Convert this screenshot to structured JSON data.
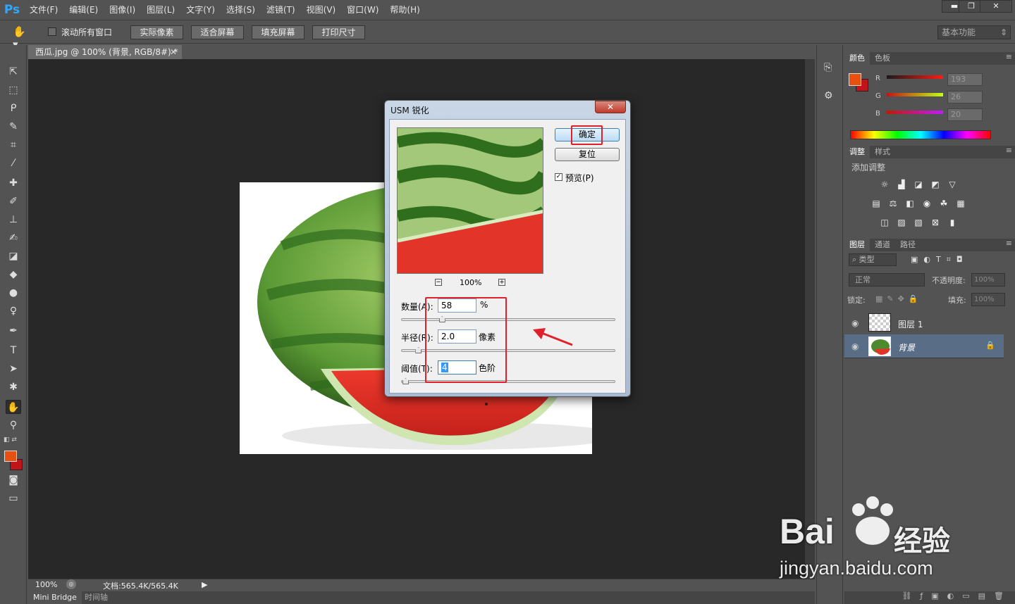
{
  "app": {
    "logo": "Ps"
  },
  "menu": [
    "文件(F)",
    "编辑(E)",
    "图像(I)",
    "图层(L)",
    "文字(Y)",
    "选择(S)",
    "滤镜(T)",
    "视图(V)",
    "窗口(W)",
    "帮助(H)"
  ],
  "window_buttons": [
    "▬",
    "❐",
    "✕"
  ],
  "options": {
    "scroll_all_label": "滚动所有窗口",
    "scroll_all_checked": false,
    "buttons": [
      "实际像素",
      "适合屏幕",
      "填充屏幕",
      "打印尺寸"
    ],
    "workspace": "基本功能"
  },
  "document": {
    "tab_title": "西瓜.jpg @ 100% (背景, RGB/8#) *",
    "zoom": "100%",
    "doc_info": "文档:565.4K/565.4K"
  },
  "bottom_tabs": [
    "Mini Bridge",
    "时间轴"
  ],
  "color_panel": {
    "tabs": [
      "颜色",
      "色板"
    ],
    "channels": [
      {
        "label": "R",
        "value": "193"
      },
      {
        "label": "G",
        "value": "26"
      },
      {
        "label": "B",
        "value": "20"
      }
    ],
    "fg_color": "#e8500f",
    "bg_color": "#c1141a"
  },
  "adjust_panel": {
    "tabs": [
      "调整",
      "样式"
    ],
    "title": "添加调整"
  },
  "layers_panel": {
    "tabs": [
      "图层",
      "通道",
      "路径"
    ],
    "filter": "类型",
    "blend_mode": "正常",
    "opacity_label": "不透明度:",
    "opacity": "100%",
    "lock_label": "锁定:",
    "fill_label": "填充:",
    "fill": "100%",
    "layers": [
      {
        "name": "图层 1",
        "selected": false
      },
      {
        "name": "背景",
        "selected": true
      }
    ]
  },
  "dialog": {
    "title": "USM 锐化",
    "close": "✕",
    "ok": "确定",
    "reset": "复位",
    "preview_label": "预览(P)",
    "preview_checked": true,
    "zoom_out": "−",
    "zoom_in": "+",
    "preview_zoom": "100%",
    "amount_label": "数量(A):",
    "amount": "58",
    "amount_unit": "%",
    "amount_slider": 0.19,
    "radius_label": "半径(R):",
    "radius": "2.0",
    "radius_unit": "像素",
    "radius_slider": 0.08,
    "threshold_label": "阈值(T):",
    "threshold": "4",
    "threshold_unit": "色阶",
    "threshold_slider": 0.02
  },
  "watermark": {
    "brand": "Bai",
    "brand2": "经验",
    "url": "jingyan.baidu.com"
  }
}
